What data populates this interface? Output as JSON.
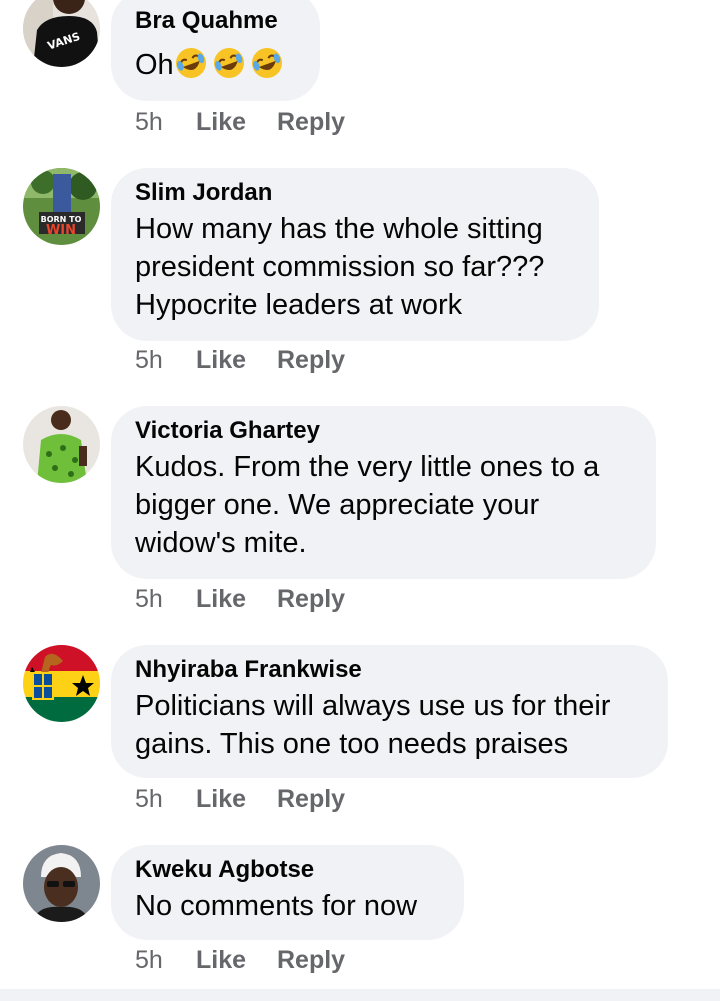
{
  "comments": [
    {
      "author": "Bra Quahme",
      "text": "Oh",
      "emoji_count": 3,
      "emoji_icon": "rolling-on-floor-laughing-emoji",
      "time": "5h",
      "like_label": "Like",
      "reply_label": "Reply"
    },
    {
      "author": "Slim Jordan",
      "lines": [
        "How many has the whole sitting",
        "president commission so far???",
        "Hypocrite leaders at work"
      ],
      "avatar_caption_top": "BORN TO",
      "avatar_caption_bottom": "WIN",
      "time": "5h",
      "like_label": "Like",
      "reply_label": "Reply"
    },
    {
      "author": "Victoria Ghartey",
      "lines": [
        "Kudos. From the very little ones to a",
        "bigger one. We appreciate your",
        "widow's mite."
      ],
      "time": "5h",
      "like_label": "Like",
      "reply_label": "Reply"
    },
    {
      "author": "Nhyiraba Frankwise",
      "lines": [
        "Politicians will always use us for their",
        "gains. This one too needs praises"
      ],
      "time": "5h",
      "like_label": "Like",
      "reply_label": "Reply"
    },
    {
      "author": "Kweku Agbotse",
      "lines": [
        "No comments for now"
      ],
      "time": "5h",
      "like_label": "Like",
      "reply_label": "Reply"
    }
  ],
  "colors": {
    "bubble": "#f0f2f5",
    "meta_text": "#65676b",
    "text": "#050505"
  }
}
